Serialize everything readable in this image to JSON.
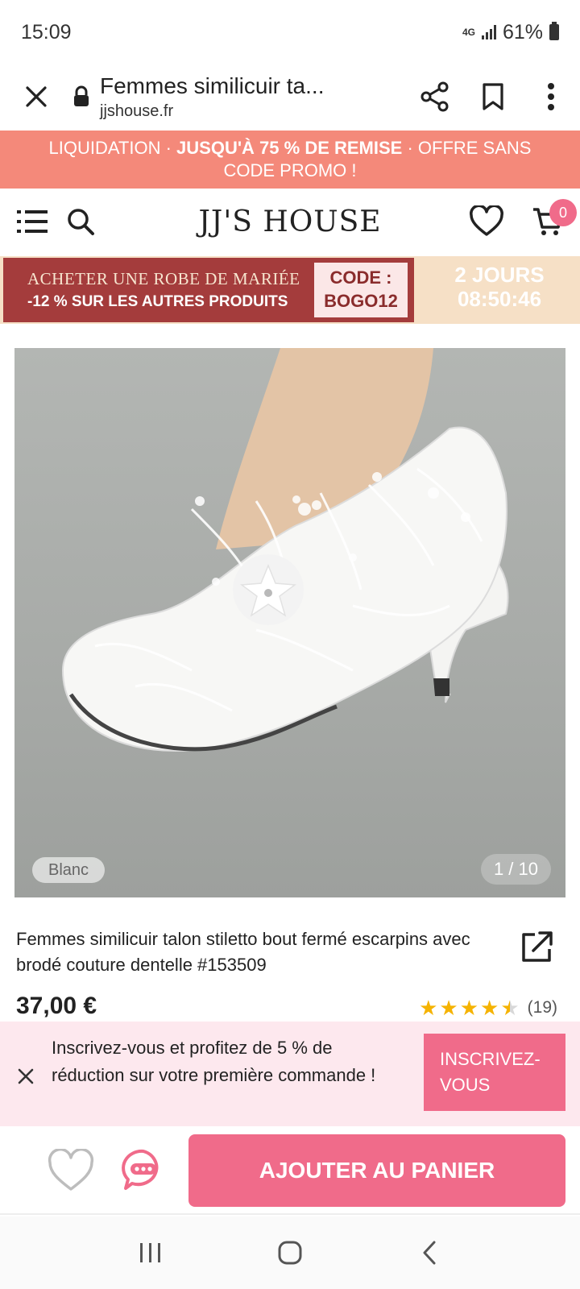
{
  "status_bar": {
    "time": "15:09",
    "network": "4G",
    "battery": "61%"
  },
  "browser": {
    "page_title": "Femmes similicuir ta...",
    "domain": "jjshouse.fr"
  },
  "promo_banner": {
    "part1": "LIQUIDATION · ",
    "bold": "JUSQU'À 75 % DE REMISE",
    "part2": " · OFFRE SANS CODE PROMO !"
  },
  "header": {
    "logo": "JJ'S HOUSE",
    "cart_count": "0"
  },
  "bride_banner": {
    "line1": "ACHETER UNE ROBE DE MARIÉE",
    "line2": "-12 % SUR LES AUTRES PRODUITS",
    "code_label": "CODE :",
    "code_value": "BOGO12",
    "days": "2 JOURS",
    "countdown": "08:50:46"
  },
  "product": {
    "color_label": "Blanc",
    "image_counter": "1 / 10",
    "title": "Femmes similicuir talon stiletto bout fermé escarpins avec brodé couture dentelle #153509",
    "price": "37,00 €",
    "rating": 4.5,
    "review_count": "(19)"
  },
  "signup": {
    "text": "Inscrivez-vous et profitez de 5 % de réduction sur votre première commande !",
    "button": "INSCRIVEZ-VOUS"
  },
  "action_bar": {
    "add_to_cart": "AJOUTER AU PANIER"
  },
  "colors": {
    "promo_bg": "#f4897a",
    "accent_pink": "#f06b8a",
    "banner_red": "#a43c3c",
    "banner_beige": "#f6e0c6",
    "star": "#f5b301"
  }
}
